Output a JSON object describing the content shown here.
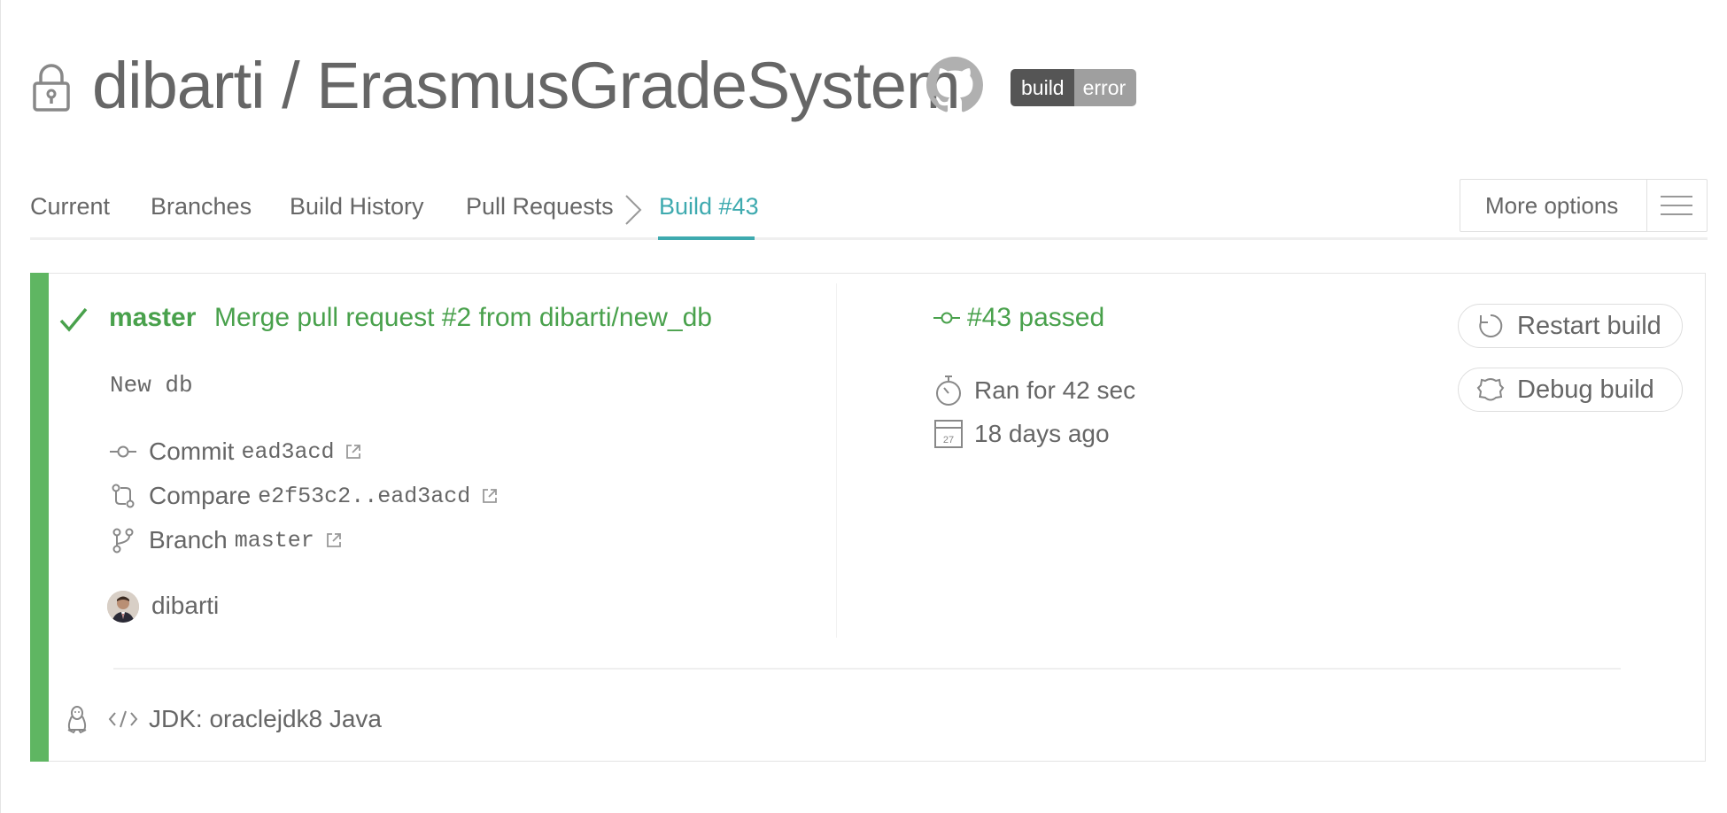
{
  "header": {
    "owner": "dibarti",
    "separator": "/",
    "repo": "ErasmusGradeSystem",
    "badge": {
      "left": "build",
      "right": "error"
    }
  },
  "nav": {
    "tabs": [
      {
        "label": "Current"
      },
      {
        "label": "Branches"
      },
      {
        "label": "Build History"
      },
      {
        "label": "Pull Requests"
      },
      {
        "label": "Build #43"
      }
    ],
    "active": "Build #43",
    "more_options": "More options"
  },
  "build": {
    "branch": "master",
    "message": "Merge pull request #2 from dibarti/new_db",
    "description": "New db",
    "commit": {
      "label": "Commit",
      "value": "ead3acd"
    },
    "compare": {
      "label": "Compare",
      "value": "e2f53c2..ead3acd"
    },
    "branch_row": {
      "label": "Branch",
      "value": "master"
    },
    "author": "dibarti",
    "status": "#43 passed",
    "duration": "Ran for 42 sec",
    "finished": "18 days ago",
    "calendar_day": "27",
    "restart_label": "Restart build",
    "debug_label": "Debug build",
    "jdk": "JDK: oraclejdk8 Java",
    "status_color": "#49a14c",
    "accent_color": "#3eaaaf"
  }
}
